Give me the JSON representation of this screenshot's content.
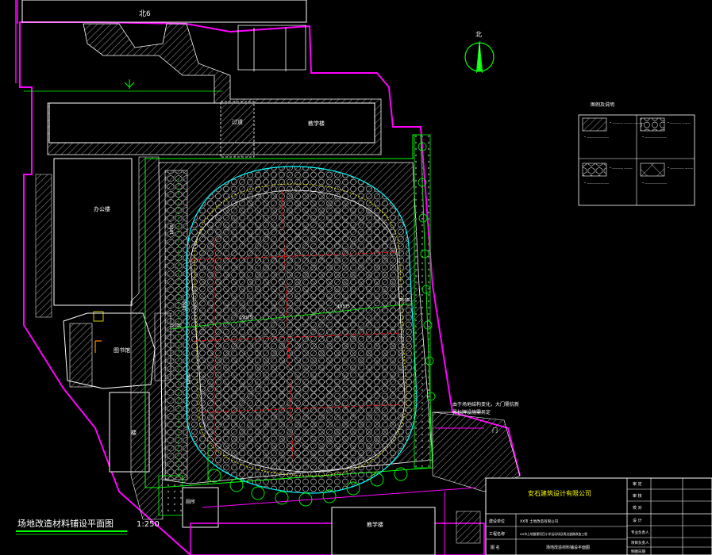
{
  "drawing": {
    "title": "场地改造材料铺设平面图",
    "scale": "1:250",
    "north_label": "北"
  },
  "buildings": {
    "road_top": "北6",
    "building_top": "教学楼",
    "passage": "过道",
    "office": "办公楼",
    "gate_building": "图书馆",
    "small_building": "楼",
    "canteen": "厕所",
    "bottom_building": "教学楼",
    "gate": "门"
  },
  "dimensions": {
    "d1": "1000",
    "d2": "5000",
    "d3": "19375",
    "d4": "19375",
    "d5": "7500",
    "d6": "1000",
    "d7": "1000"
  },
  "annotation": {
    "line1": "由于场地结构变化，大门需抗新",
    "line2": "界标牌设施需另定"
  },
  "legend": {
    "title": "图例及说明",
    "items": [
      {
        "label_a": "• ———— ——— ————",
        "label_b": "• ————————"
      },
      {
        "label_a": "• ———— ———",
        "label_b": "• ————————"
      },
      {
        "label_a": "• ———— ———",
        "label_b": "• ————————"
      },
      {
        "label_a": "• ————— ———",
        "label_b": "• ————————"
      }
    ]
  },
  "title_block": {
    "company": "安石建筑设计有限公司",
    "role_labels": [
      "审 定",
      "审 核",
      "校 对",
      "设 计",
      "专业负责人",
      "项目负责人",
      "制图日期"
    ],
    "row_labels": [
      "建设单位",
      "工程名称",
      "图 名"
    ],
    "row_values": [
      "XX市 土地改造有限公司",
      "XX市土地整理项目小学运动场及周边道路改造工程",
      "场地改造材料铺设平面图"
    ]
  },
  "colors": {
    "magenta": "#ff00ff",
    "white": "#ffffff",
    "green": "#00ff00",
    "cyan": "#00ffff",
    "red": "#ff0000",
    "yellow": "#ffff00"
  }
}
